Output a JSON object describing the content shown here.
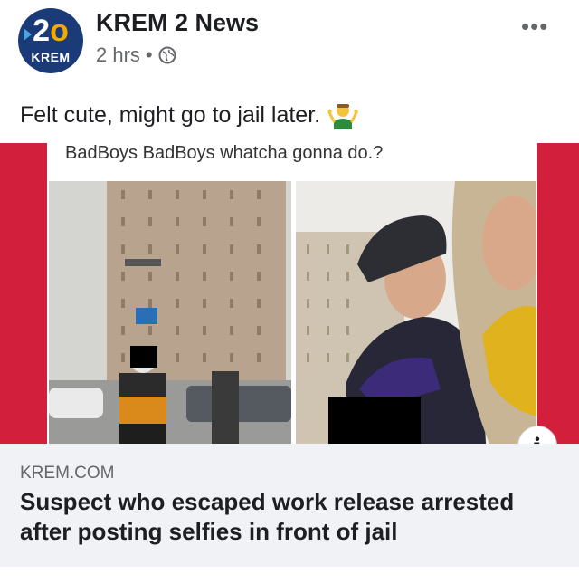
{
  "post": {
    "page_name": "KREM 2 News",
    "time": "2 hrs",
    "separator": "•",
    "avatar_number": "2",
    "avatar_brand": "KREM",
    "more_label": "•••",
    "caption": "Felt cute, might go to jail later.",
    "caption_emoji": "person-shrugging",
    "privacy_icon": "globe-icon"
  },
  "media": {
    "meme_text": "BadBoys BadBoys whatcha gonna do.?",
    "accent_color": "#d21f3c"
  },
  "link": {
    "domain": "KREM.COM",
    "headline": "Suspect who escaped work release arrested after posting selfies in front of jail",
    "info_label": "i"
  }
}
